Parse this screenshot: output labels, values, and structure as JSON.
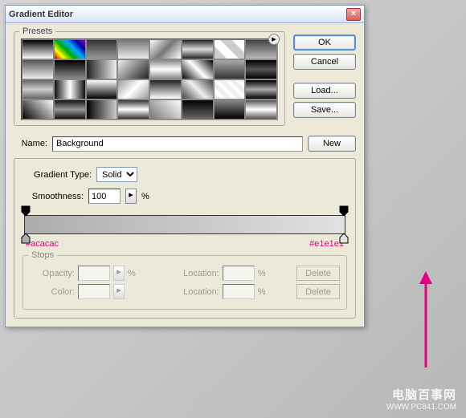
{
  "title": "Gradient Editor",
  "presets_label": "Presets",
  "buttons": {
    "ok": "OK",
    "cancel": "Cancel",
    "load": "Load...",
    "save": "Save...",
    "new": "New"
  },
  "name_label": "Name:",
  "name_value": "Background",
  "gradient_type_label": "Gradient Type:",
  "gradient_type_value": "Solid",
  "smoothness_label": "Smoothness:",
  "smoothness_value": "100",
  "percent": "%",
  "color_left": "#acacac",
  "color_right": "#e1e1e1",
  "stops_label": "Stops",
  "stops": {
    "opacity": "Opacity:",
    "location": "Location:",
    "color": "Color:",
    "delete": "Delete"
  },
  "swatches": [
    "linear-gradient(#000,#fff)",
    "linear-gradient(45deg,#a00,#ff0,#0a0,#0af,#00a,#a0a)",
    "linear-gradient(#333,#999)",
    "linear-gradient(#777,#eee)",
    "linear-gradient(135deg,#fff,#777,#fff)",
    "linear-gradient(#222,#ddd,#222)",
    "linear-gradient(45deg,#ccc 25%,#fff 25%,#fff 50%,#ccc 50%,#ccc 75%,#fff 75%)",
    "linear-gradient(#444,#bbb)",
    "linear-gradient(#555,#eee)",
    "linear-gradient(#000,#888)",
    "linear-gradient(90deg,#222,#eee)",
    "linear-gradient(135deg,#eee,#222)",
    "linear-gradient(#888,#fff,#888)",
    "linear-gradient(45deg,#000,#fff,#000)",
    "linear-gradient(#aaa,#333)",
    "linear-gradient(#000,#555,#000)",
    "linear-gradient(#666,#ccc,#666)",
    "linear-gradient(90deg,#111,#fff,#111)",
    "linear-gradient(#fff,#000)",
    "linear-gradient(135deg,#999,#fff,#999)",
    "linear-gradient(#222,#fff)",
    "linear-gradient(45deg,#444,#eee,#444)",
    "repeating-linear-gradient(45deg,#eee 0 5px,#fff 5px 10px)",
    "linear-gradient(#000,#aaa,#000)",
    "linear-gradient(45deg,#000,#fff)",
    "linear-gradient(#111,#999,#111)",
    "linear-gradient(90deg,#000,#ccc)",
    "linear-gradient(#333,#fff,#333)",
    "linear-gradient(45deg,#777,#fff)",
    "linear-gradient(#000,#666)",
    "linear-gradient(#888,#000)",
    "linear-gradient(#555,#fff,#555)"
  ],
  "watermark": {
    "cn": "电脑百事网",
    "url": "WWW.PC841.COM"
  }
}
